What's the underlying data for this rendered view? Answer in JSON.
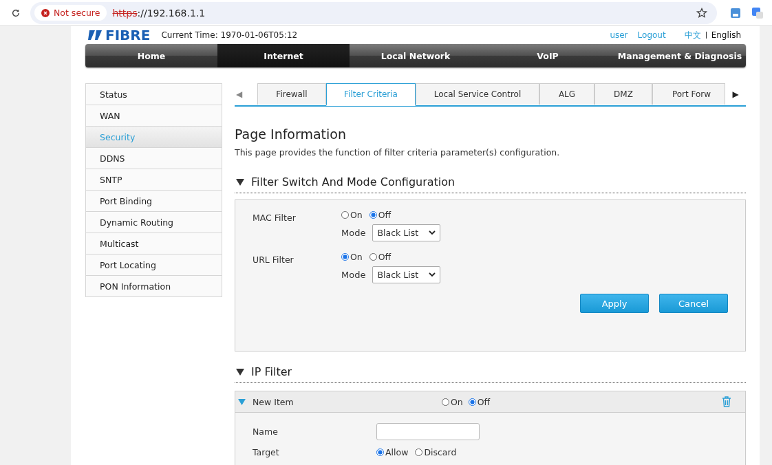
{
  "browser": {
    "security": "Not secure",
    "url_scheme": "https",
    "url_rest": "://192.168.1.1"
  },
  "header": {
    "logo": "FIBRE",
    "current_time": "Current Time: 1970-01-06T05:12",
    "links": [
      "user",
      "Logout"
    ],
    "languages": [
      {
        "label": "中文",
        "selected": false
      },
      {
        "label": "English",
        "selected": true
      }
    ]
  },
  "nav": [
    {
      "label": "Home",
      "selected": false
    },
    {
      "label": "Internet",
      "selected": true
    },
    {
      "label": "Local Network",
      "selected": false
    },
    {
      "label": "VoIP",
      "selected": false
    },
    {
      "label": "Management & Diagnosis",
      "selected": false
    }
  ],
  "sidebar": {
    "items": [
      {
        "label": "Status",
        "selected": false
      },
      {
        "label": "WAN",
        "selected": false
      },
      {
        "label": "Security",
        "selected": true
      },
      {
        "label": "DDNS",
        "selected": false
      },
      {
        "label": "SNTP",
        "selected": false
      },
      {
        "label": "Port Binding",
        "selected": false
      },
      {
        "label": "Dynamic Routing",
        "selected": false
      },
      {
        "label": "Multicast",
        "selected": false
      },
      {
        "label": "Port Locating",
        "selected": false
      },
      {
        "label": "PON Information",
        "selected": false
      }
    ]
  },
  "tabs": {
    "prev": "◀",
    "next": "▶",
    "items": [
      {
        "label": "Firewall",
        "selected": false
      },
      {
        "label": "Filter Criteria",
        "selected": true
      },
      {
        "label": "Local Service Control",
        "selected": false
      },
      {
        "label": "ALG",
        "selected": false
      },
      {
        "label": "DMZ",
        "selected": false
      },
      {
        "label": "Port Forw",
        "selected": false
      }
    ]
  },
  "page_info": {
    "title": "Page Information",
    "description": "This page provides the function of filter criteria parameter(s) configuration."
  },
  "filter_section": {
    "title": "Filter Switch And Mode Configuration",
    "expanded": true,
    "rows": [
      {
        "label": "MAC Filter",
        "options": [
          {
            "label": "On",
            "selected": false
          },
          {
            "label": "Off",
            "selected": true
          }
        ],
        "mode_label": "Mode",
        "mode_value": "Black List"
      },
      {
        "label": "URL Filter",
        "options": [
          {
            "label": "On",
            "selected": true
          },
          {
            "label": "Off",
            "selected": false
          }
        ],
        "mode_label": "Mode",
        "mode_value": "Black List"
      }
    ],
    "buttons": [
      "Apply",
      "Cancel"
    ]
  },
  "ip_section": {
    "title": "IP Filter",
    "expanded": true,
    "item": {
      "title": "New Item",
      "expanded": true,
      "options": [
        {
          "label": "On",
          "selected": false
        },
        {
          "label": "Off",
          "selected": true
        }
      ],
      "fields": [
        {
          "kind": "text",
          "label": "Name"
        },
        {
          "kind": "radio",
          "label": "Target",
          "options": [
            {
              "label": "Allow",
              "selected": true
            },
            {
              "label": "Discard",
              "selected": false
            }
          ]
        }
      ]
    }
  }
}
